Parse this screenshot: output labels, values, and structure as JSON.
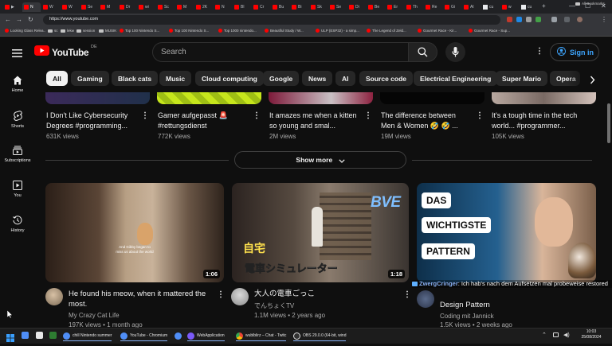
{
  "browser": {
    "tabs": [
      {
        "label": "▶",
        "active": false
      },
      {
        "label": "N",
        "active": true
      },
      {
        "label": "W",
        "active": false
      },
      {
        "label": "W",
        "active": false
      },
      {
        "label": "Se",
        "active": false
      },
      {
        "label": "M",
        "active": false
      },
      {
        "label": "Dr",
        "active": false
      },
      {
        "label": "wi",
        "active": false
      },
      {
        "label": "Sc",
        "active": false
      },
      {
        "label": "M",
        "active": false
      },
      {
        "label": "2K",
        "active": false
      },
      {
        "label": "N",
        "active": false
      },
      {
        "label": "Bl",
        "active": false
      },
      {
        "label": "Cr",
        "active": false
      },
      {
        "label": "Bu",
        "active": false
      },
      {
        "label": "Bi",
        "active": false
      },
      {
        "label": "Sk",
        "active": false
      },
      {
        "label": "Se",
        "active": false
      },
      {
        "label": "Di",
        "active": false
      },
      {
        "label": "Be",
        "active": false
      },
      {
        "label": "Er",
        "active": false
      },
      {
        "label": "Th",
        "active": false
      },
      {
        "label": "Re",
        "active": false
      },
      {
        "label": "Gi",
        "active": false
      },
      {
        "label": "Al",
        "active": false
      },
      {
        "label": "cu",
        "active": false
      },
      {
        "label": "w",
        "active": false
      },
      {
        "label": "cu",
        "active": false
      }
    ],
    "url": "https://www.youtube.com",
    "bookmarks": [
      "Looking Glass Relea...",
      "sc",
      "lekw",
      "session",
      "MUSIK",
      "Top 100 Nintendo S...",
      "Top 100 Nintendo S...",
      "Top 1000 nintendo...",
      "Beautiful Study / W...",
      "ULP (ESP32) - a simp...",
      "The Legend of Zeld...",
      "Gourmet Race - Kir...",
      "Gourmet Race - Sup..."
    ],
    "all_bookmarks_label": "All Bookmarks"
  },
  "youtube": {
    "logo_text": "YouTube",
    "region": "DE",
    "search_placeholder": "Search",
    "signin_label": "Sign in",
    "chips": [
      "All",
      "Gaming",
      "Black cats",
      "Music",
      "Cloud computing",
      "Google",
      "News",
      "AI",
      "Source code",
      "Electrical Engineering",
      "Super Mario",
      "Opera"
    ],
    "sidebar": [
      {
        "label": "Home",
        "icon": "home-icon"
      },
      {
        "label": "Shorts",
        "icon": "shorts-icon"
      },
      {
        "label": "Subscriptions",
        "icon": "subscriptions-icon"
      },
      {
        "label": "You",
        "icon": "you-icon"
      },
      {
        "label": "History",
        "icon": "history-icon"
      }
    ],
    "shorts": [
      {
        "title": "I Don't Like Cybersecurity Degrees #programming...",
        "views": "631K views"
      },
      {
        "title": "Gamer aufgepasst 🚨 #rettungsdienst",
        "views": "772K views"
      },
      {
        "title": "It amazes me when a kitten so young and smal...",
        "views": "2M views"
      },
      {
        "title": "The difference between Men & Women 🤣 🤣 ...",
        "views": "19M views"
      },
      {
        "title": "It's a tough time in the tech world... #programmer...",
        "views": "105K views"
      }
    ],
    "show_more_label": "Show more",
    "videos": [
      {
        "title": "He found his meow, when it mattered the most.",
        "channel": "My Crazy Cat Life",
        "views": "197K views",
        "age": "1 month ago",
        "duration": "1:06",
        "caption": "And Gibby began to miss us about the world"
      },
      {
        "title": "大人の電車ごっこ",
        "channel": "でんちょくTV",
        "views": "1.1M views",
        "age": "2 years ago",
        "duration": "1:18",
        "overlay_top": "BVE",
        "overlay_left": "自宅",
        "overlay_bottom": "電車シミュレーター"
      },
      {
        "title": "Design Pattern",
        "channel": "Coding mit Jannick",
        "views": "1.5K views",
        "age": "2 weeks ago",
        "thumb_words": [
          "DAS",
          "WICHTIGSTE",
          "PATTERN"
        ]
      }
    ]
  },
  "chat_overlay": {
    "user": "ZwergCringer",
    "message": ": Ich hab's nach dem Aufsetzen mal probeweise restored"
  },
  "taskbar": {
    "items": [
      {
        "label": "chill Nintendo summer",
        "color": "#4f8ef7"
      },
      {
        "label": "YouTube - Chromium",
        "color": "#4f8ef7"
      },
      {
        "label": "",
        "color": "#4f8ef7"
      },
      {
        "label": "WebApplication",
        "color": "#7a5af8"
      },
      {
        "label": "wublblirz – Chat - Twitc",
        "color": "#e0e0e0"
      },
      {
        "label": "OBS 29.0.0 (64-bit, wind",
        "color": "#333333"
      }
    ],
    "time": "10:03",
    "date": "25/08/2024"
  },
  "colors": {
    "yt_red": "#ff0000",
    "link_blue": "#3ea6ff",
    "chat_user": "#8ab4f8"
  }
}
